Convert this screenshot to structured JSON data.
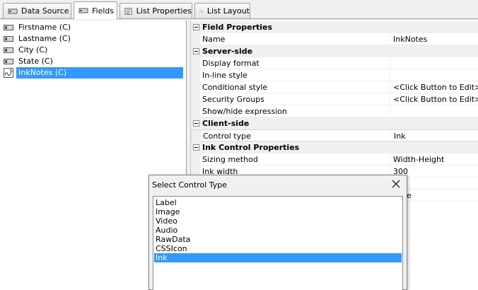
{
  "tabs": [
    {
      "label": "Data Source",
      "icon": "database-icon"
    },
    {
      "label": "Fields",
      "icon": "fields-icon",
      "active": true
    },
    {
      "label": "List Properties",
      "icon": "list-properties-icon"
    },
    {
      "label": "List Layout",
      "icon": "list-layout-icon"
    }
  ],
  "fields": [
    {
      "label": "Firstname (C)",
      "icon": "textbox-field-icon"
    },
    {
      "label": "Lastname (C)",
      "icon": "textbox-field-icon"
    },
    {
      "label": "City (C)",
      "icon": "textbox-field-icon"
    },
    {
      "label": "State (C)",
      "icon": "textbox-field-icon"
    },
    {
      "label": "InkNotes (C)",
      "icon": "ink-field-icon",
      "selected": true
    }
  ],
  "properties": {
    "field_properties": {
      "label": "Field Properties",
      "toggle": "−"
    },
    "name": {
      "label": "Name",
      "value": "InkNotes"
    },
    "server_side": {
      "label": "Server-side",
      "toggle": "−"
    },
    "display_format": {
      "label": "Display format",
      "value": ""
    },
    "inline_style": {
      "label": "In-line style",
      "value": ""
    },
    "conditional_style": {
      "label": "Conditional style",
      "value": "<Click Button to Edit>"
    },
    "security_groups": {
      "label": "Security Groups",
      "value": "<Click Button to Edit>"
    },
    "show_hide": {
      "label": "Show/hide expression",
      "value": ""
    },
    "client_side": {
      "label": "Client-side",
      "toggle": "−"
    },
    "control_type": {
      "label": "Control type",
      "value": "Ink"
    },
    "ink_control": {
      "label": "Ink Control Properties",
      "toggle": "−"
    },
    "sizing_method": {
      "label": "Sizing method",
      "value": "Width-Height"
    },
    "ink_width": {
      "label": "Ink width",
      "value": "300"
    },
    "partial_value": {
      "label": "",
      "value": "e"
    }
  },
  "dialog": {
    "title": "Select Control Type",
    "options": [
      "Label",
      "Image",
      "Video",
      "Audio",
      "RawData",
      "CSSIcon",
      "Ink"
    ],
    "selected": "Ink"
  },
  "colors": {
    "selection": "#3399ff",
    "category_bg": "#f0f0f0"
  }
}
